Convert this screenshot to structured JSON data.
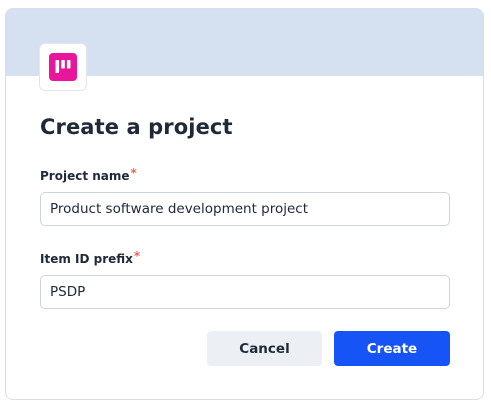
{
  "dialog": {
    "title": "Create a project",
    "app_icon": "board-columns-icon",
    "colors": {
      "header_band": "#d5e0f1",
      "icon_accent": "#e8169b",
      "primary": "#1754f5",
      "required_marker": "#e5675a"
    }
  },
  "fields": {
    "project_name": {
      "label": "Project name",
      "required_marker": "*",
      "value": "Product software development project"
    },
    "item_id_prefix": {
      "label": "Item ID prefix",
      "required_marker": "*",
      "value": "PSDP"
    }
  },
  "actions": {
    "cancel_label": "Cancel",
    "create_label": "Create"
  }
}
